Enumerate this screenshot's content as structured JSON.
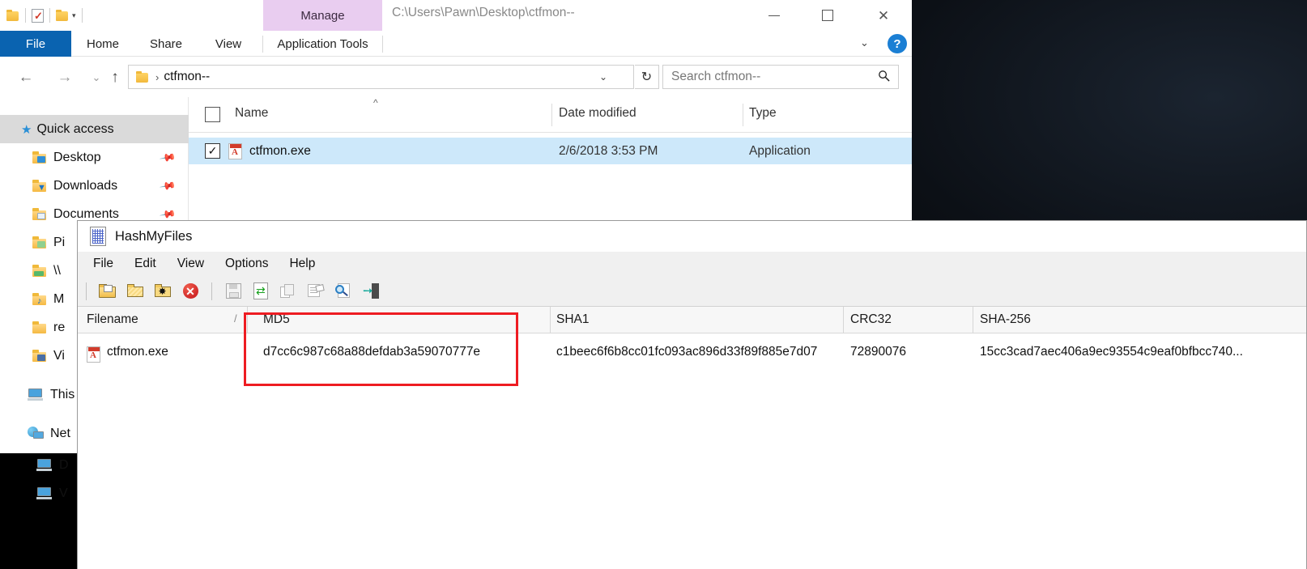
{
  "explorer": {
    "window_title": "C:\\Users\\Pawn\\Desktop\\ctfmon--",
    "quick_access_toolbar": {
      "folder_icon": "folder-icon",
      "properties_icon": "properties-document-icon",
      "new_folder_icon": "new-folder-icon",
      "customize_caret": "▾"
    },
    "window_controls": {
      "minimize": "—",
      "maximize": "□",
      "close": "✕"
    },
    "contextual_tab_group": "Manage",
    "ribbon_tabs": [
      {
        "label": "File"
      },
      {
        "label": "Home"
      },
      {
        "label": "Share"
      },
      {
        "label": "View"
      },
      {
        "label": "Application Tools"
      }
    ],
    "ribbon_collapse_caret": "⌄",
    "help_label": "?",
    "navigation": {
      "back": "←",
      "forward": "→",
      "recent": "⌄",
      "up": "↑"
    },
    "address": {
      "text": "ctfmon--",
      "separator": "›",
      "dropdown": "⌄"
    },
    "refresh_glyph": "↻",
    "search": {
      "placeholder": "Search ctfmon--",
      "icon": "🔍"
    },
    "sidebar": [
      {
        "label": "Quick access",
        "icon": "star-icon",
        "selected": true
      },
      {
        "label": "Desktop",
        "icon": "desktop-folder-icon",
        "pinned": true
      },
      {
        "label": "Downloads",
        "icon": "downloads-folder-icon",
        "pinned": true
      },
      {
        "label": "Documents",
        "icon": "documents-folder-icon",
        "pinned": true
      },
      {
        "label": "Pi",
        "icon": "pictures-folder-icon",
        "pinned": false
      },
      {
        "label": "\\\\",
        "icon": "network-folder-icon",
        "pinned": false
      },
      {
        "label": "M",
        "icon": "music-folder-icon",
        "pinned": false
      },
      {
        "label": "re",
        "icon": "folder-icon",
        "pinned": false
      },
      {
        "label": "Vi",
        "icon": "videos-folder-icon",
        "pinned": false
      },
      {
        "label": "This",
        "icon": "this-pc-icon",
        "pinned": false
      },
      {
        "label": "Net",
        "icon": "network-icon",
        "pinned": false
      },
      {
        "label": "D",
        "icon": "computer-icon",
        "pinned": false
      },
      {
        "label": "V",
        "icon": "computer-icon",
        "pinned": false
      }
    ],
    "columns": [
      {
        "label": "Name"
      },
      {
        "label": "Date modified"
      },
      {
        "label": "Type"
      }
    ],
    "sort_indicator": "^",
    "select_all_checkbox": "",
    "files": [
      {
        "checked": "✓",
        "name": "ctfmon.exe",
        "date_modified": "2/6/2018 3:53 PM",
        "type": "Application",
        "icon": "pdf-file-icon"
      }
    ]
  },
  "hashmyfiles": {
    "title": "HashMyFiles",
    "app_icon": "hashmyfiles-icon",
    "menu": [
      {
        "label": "File"
      },
      {
        "label": "Edit"
      },
      {
        "label": "View"
      },
      {
        "label": "Options"
      },
      {
        "label": "Help"
      }
    ],
    "toolbar": [
      {
        "name": "add-files-icon",
        "tooltip": "Add Files"
      },
      {
        "name": "add-folder-icon",
        "tooltip": "Add Folder"
      },
      {
        "name": "add-folder-wildcard-icon",
        "tooltip": "Add Folder With Wildcard"
      },
      {
        "name": "clear-all-icon",
        "tooltip": "Clear All"
      },
      {
        "name": "save-icon",
        "tooltip": "Save Selected Items"
      },
      {
        "name": "refresh-icon",
        "tooltip": "Refresh"
      },
      {
        "name": "copy-icon",
        "tooltip": "Copy Selected Items"
      },
      {
        "name": "properties-icon",
        "tooltip": "Properties"
      },
      {
        "name": "find-icon",
        "tooltip": "Find"
      },
      {
        "name": "exit-icon",
        "tooltip": "Exit"
      }
    ],
    "columns": [
      {
        "label": "Filename",
        "sort_mark": "/"
      },
      {
        "label": "MD5"
      },
      {
        "label": "SHA1"
      },
      {
        "label": "CRC32"
      },
      {
        "label": "SHA-256"
      }
    ],
    "rows": [
      {
        "filename": "ctfmon.exe",
        "file_icon": "pdf-file-icon",
        "md5": "d7cc6c987c68a88defdab3a59070777e",
        "sha1": "c1beec6f6b8cc01fc093ac896d33f89f885e7d07",
        "crc32": "72890076",
        "sha256": "15cc3cad7aec406a9ec93554c9eaf0bfbcc740..."
      }
    ],
    "highlight": {
      "column": "MD5",
      "color": "#ee1c22"
    }
  }
}
